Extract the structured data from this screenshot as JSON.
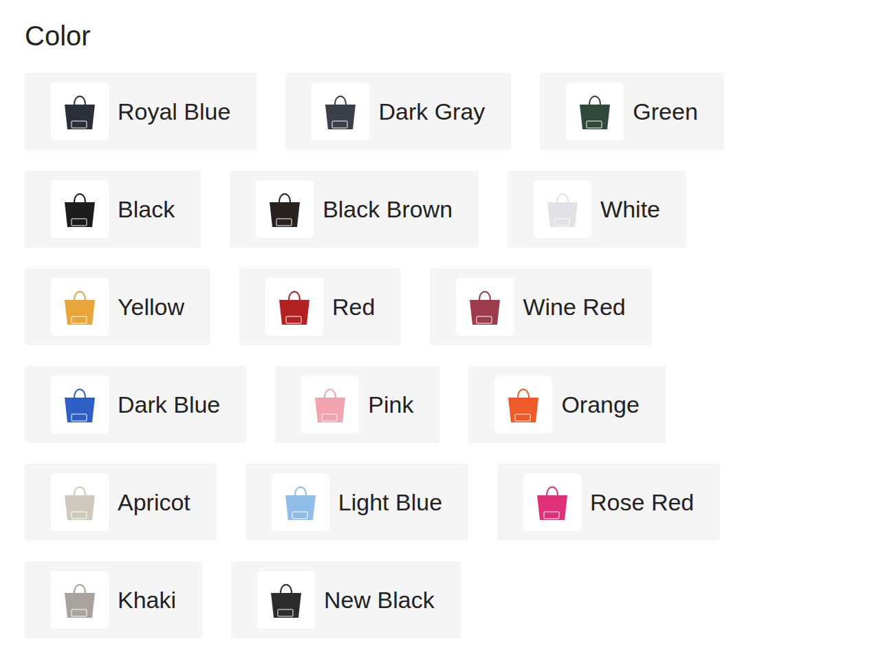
{
  "section": {
    "title": "Color"
  },
  "options": [
    {
      "label": "Royal Blue",
      "selected": false,
      "color": "#2a2f3a"
    },
    {
      "label": "Dark Gray",
      "selected": false,
      "color": "#3a3f4a"
    },
    {
      "label": "Green",
      "selected": false,
      "color": "#2f4a3c"
    },
    {
      "label": "Black",
      "selected": false,
      "color": "#1c1c1c"
    },
    {
      "label": "Black Brown",
      "selected": false,
      "color": "#2a2220"
    },
    {
      "label": "White",
      "selected": false,
      "color": "#e2e2e6"
    },
    {
      "label": "Yellow",
      "selected": false,
      "color": "#e8a53a"
    },
    {
      "label": "Red",
      "selected": false,
      "color": "#b22222"
    },
    {
      "label": "Wine Red",
      "selected": false,
      "color": "#9c3b4a"
    },
    {
      "label": "Dark Blue",
      "selected": false,
      "color": "#2f5fc4"
    },
    {
      "label": "Pink",
      "selected": false,
      "color": "#f2a3b0"
    },
    {
      "label": "Orange",
      "selected": false,
      "color": "#ef5a2a"
    },
    {
      "label": "Apricot",
      "selected": false,
      "color": "#cfc8bd"
    },
    {
      "label": "Light Blue",
      "selected": false,
      "color": "#8fbde8"
    },
    {
      "label": "Rose Red",
      "selected": false,
      "color": "#e0307a"
    },
    {
      "label": "Khaki",
      "selected": false,
      "color": "#a8a49c"
    },
    {
      "label": "New Black",
      "selected": false,
      "color": "#2b2b2b"
    }
  ]
}
